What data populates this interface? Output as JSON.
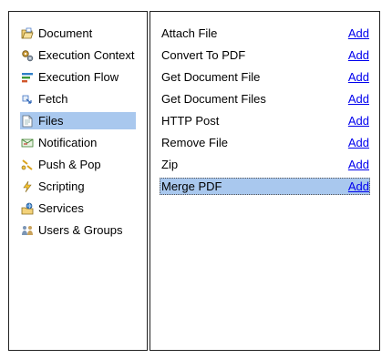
{
  "categories": [
    {
      "label": "Document",
      "icon": "folder-open-icon"
    },
    {
      "label": "Execution Context",
      "icon": "gears-icon"
    },
    {
      "label": "Execution Flow",
      "icon": "flow-icon"
    },
    {
      "label": "Fetch",
      "icon": "fetch-icon"
    },
    {
      "label": "Files",
      "icon": "file-icon",
      "selected": true
    },
    {
      "label": "Notification",
      "icon": "notification-icon"
    },
    {
      "label": "Push & Pop",
      "icon": "push-pop-icon"
    },
    {
      "label": "Scripting",
      "icon": "scripting-icon"
    },
    {
      "label": "Services",
      "icon": "services-icon"
    },
    {
      "label": "Users & Groups",
      "icon": "users-groups-icon"
    }
  ],
  "actions": [
    {
      "label": "Attach File",
      "link": "Add"
    },
    {
      "label": "Convert To PDF",
      "link": "Add"
    },
    {
      "label": "Get Document File",
      "link": "Add"
    },
    {
      "label": "Get Document Files",
      "link": "Add"
    },
    {
      "label": "HTTP Post",
      "link": "Add"
    },
    {
      "label": "Remove File",
      "link": "Add"
    },
    {
      "label": "Zip",
      "link": "Add"
    },
    {
      "label": "Merge PDF",
      "link": "Add",
      "selected": true
    }
  ],
  "colors": {
    "selection": "#a9c8ee",
    "link": "#0000ee",
    "border": "#222222"
  }
}
